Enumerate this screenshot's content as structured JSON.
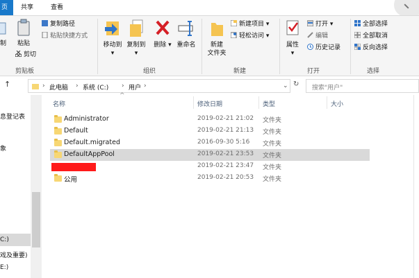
{
  "tabs": {
    "file": "页",
    "share": "共享",
    "view": "查看"
  },
  "ribbon": {
    "clipboard": {
      "cut_partial": "制",
      "paste": "粘贴",
      "copy_path": "复制路径",
      "paste_shortcut": "粘贴快捷方式",
      "cut": "剪切",
      "group": "剪贴板"
    },
    "organize": {
      "move_to": "移动到",
      "copy_to": "复制到",
      "delete": "删除",
      "rename": "重命名",
      "group": "组织"
    },
    "new": {
      "new_folder_line1": "新建",
      "new_folder_line2": "文件夹",
      "new_item": "新建项目",
      "easy_access": "轻松访问",
      "group": "新建"
    },
    "open": {
      "properties": "属性",
      "open": "打开",
      "edit": "编辑",
      "history": "历史记录",
      "group": "打开"
    },
    "select": {
      "select_all": "全部选择",
      "select_none": "全部取消",
      "invert": "反向选择",
      "group": "选择"
    }
  },
  "address": {
    "crumbs": [
      "此电脑",
      "系统 (C:)",
      "用户"
    ],
    "search_placeholder": "搜索\"用户\""
  },
  "nav": {
    "items": [
      "息登记表",
      "象",
      "C:)",
      "戏及重要)",
      "E:)"
    ]
  },
  "columns": {
    "name": "名称",
    "date": "修改日期",
    "type": "类型",
    "size": "大小"
  },
  "files": [
    {
      "name": "Administrator",
      "date": "2019-02-21 21:02",
      "type": "文件夹",
      "selected": false
    },
    {
      "name": "Default",
      "date": "2019-02-21 21:13",
      "type": "文件夹",
      "selected": false
    },
    {
      "name": "Default.migrated",
      "date": "2016-09-30 5:16",
      "type": "文件夹",
      "selected": false
    },
    {
      "name": "DefaultAppPool",
      "date": "2019-02-21 23:53",
      "type": "文件夹",
      "selected": true
    },
    {
      "name": "",
      "date": "2019-02-21 23:47",
      "type": "文件夹",
      "selected": false,
      "redacted": true
    },
    {
      "name": "公用",
      "date": "2019-02-21 20:53",
      "type": "文件夹",
      "selected": false
    }
  ],
  "colors": {
    "accent": "#1979ca",
    "folder": "#f7d774",
    "redaction": "#ff1a1a",
    "selection": "#d9d9d9"
  }
}
